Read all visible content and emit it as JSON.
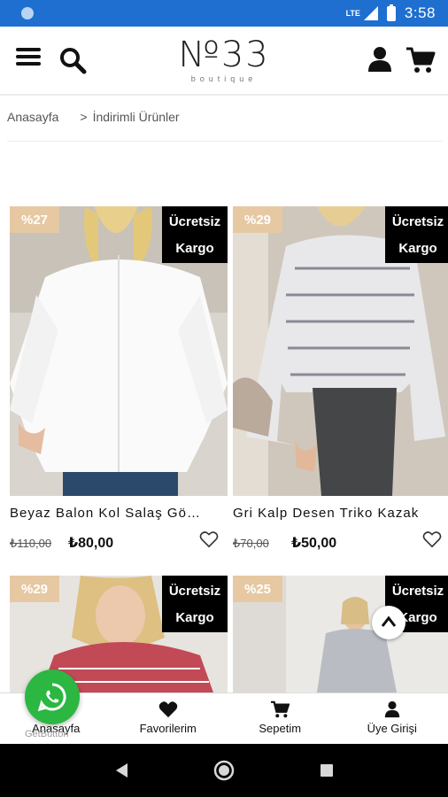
{
  "status_bar": {
    "network": "LTE",
    "time": "3:58"
  },
  "header": {
    "logo_text": "№33",
    "logo_sub": "boutique"
  },
  "breadcrumb": {
    "home": "Anasayfa",
    "separator": ">",
    "current": "İndirimli Ürünler"
  },
  "products": [
    {
      "discount": "%27",
      "ship_line1": "Ücretsiz",
      "ship_line2": "Kargo",
      "title": "Beyaz Balon Kol Salaş Gömlek",
      "old_price": "₺110,00",
      "new_price": "₺80,00"
    },
    {
      "discount": "%29",
      "ship_line1": "Ücretsiz",
      "ship_line2": "Kargo",
      "title": "Gri Kalp Desen Triko Kazak",
      "old_price": "₺70,00",
      "new_price": "₺50,00"
    },
    {
      "discount": "%29",
      "ship_line1": "Ücretsiz",
      "ship_line2": "Kargo"
    },
    {
      "discount": "%25",
      "ship_line1": "Ücretsiz",
      "ship_line2": "Kargo"
    }
  ],
  "bottom_nav": [
    {
      "label": "Anasayfa",
      "icon": "home-icon"
    },
    {
      "label": "Favorilerim",
      "icon": "heart-icon"
    },
    {
      "label": "Sepetim",
      "icon": "cart-icon"
    },
    {
      "label": "Üye Girişi",
      "icon": "user-icon"
    }
  ],
  "widget": {
    "getbutton": "GetButton"
  },
  "colors": {
    "status_bar": "#1e6fcf",
    "discount_badge": "#e6c9a3",
    "shipping_badge": "#000000",
    "whatsapp": "#2bb741"
  }
}
